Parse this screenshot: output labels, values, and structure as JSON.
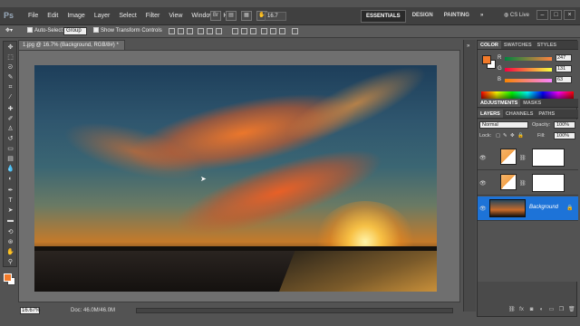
{
  "app": {
    "logo_text": "Ps"
  },
  "menu": [
    "File",
    "Edit",
    "Image",
    "Layer",
    "Select",
    "Filter",
    "View",
    "Window",
    "Help"
  ],
  "menubar": {
    "zoom_value": "16.7",
    "workspaces": [
      "ESSENTIALS",
      "DESIGN",
      "PAINTING"
    ],
    "active_workspace": "ESSENTIALS",
    "more_label": "»",
    "cs_live": "CS Live",
    "window_buttons": [
      "–",
      "□",
      "×"
    ]
  },
  "options": {
    "auto_select_label": "Auto-Select:",
    "auto_select_value": "Group",
    "transform_label": "Show Transform Controls"
  },
  "document": {
    "tab_title": "1.jpg @ 16.7% (Background, RGB/8#) *",
    "close_label": "×"
  },
  "status": {
    "zoom": "16.67%",
    "doc_size": "Doc: 46.0M/46.0M"
  },
  "colors": {
    "foreground": "#f27a29",
    "background": "#ffffff",
    "selection": "#1d73d8"
  },
  "color_panel": {
    "tabs": [
      "COLOR",
      "SWATCHES",
      "STYLES"
    ],
    "active_tab": "COLOR",
    "r": {
      "label": "R",
      "value": "247"
    },
    "g": {
      "label": "G",
      "value": "131"
    },
    "b": {
      "label": "B",
      "value": "63"
    }
  },
  "adjust_panel": {
    "tabs": [
      "ADJUSTMENTS",
      "MASKS"
    ],
    "active_tab": "ADJUSTMENTS"
  },
  "layers_panel": {
    "tabs": [
      "LAYERS",
      "CHANNELS",
      "PATHS"
    ],
    "active_tab": "LAYERS",
    "blend_mode": "Normal",
    "opacity_label": "Opacity:",
    "opacity_value": "100%",
    "lock_label": "Lock:",
    "fill_label": "Fill:",
    "fill_value": "100%",
    "layers": [
      {
        "type": "adjustment",
        "name": ""
      },
      {
        "type": "adjustment",
        "name": ""
      },
      {
        "type": "image",
        "name": "Background"
      }
    ]
  },
  "tools": [
    "move-tool",
    "marquee-tool",
    "lasso-tool",
    "quick-select-tool",
    "crop-tool",
    "eyedropper-tool",
    "healing-tool",
    "brush-tool",
    "clone-stamp-tool",
    "history-brush-tool",
    "eraser-tool",
    "gradient-tool",
    "blur-tool",
    "dodge-tool",
    "pen-tool",
    "type-tool",
    "path-select-tool",
    "shape-tool",
    "3d-rotate-tool",
    "3d-orbit-tool",
    "hand-tool",
    "zoom-tool"
  ]
}
